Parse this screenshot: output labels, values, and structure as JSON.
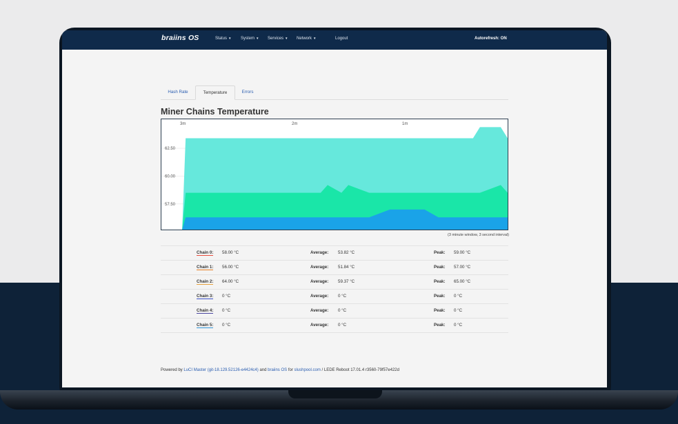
{
  "colors": {
    "navbar": "#0f2a4a",
    "link": "#2a5db0",
    "chain0": "#e74c3c",
    "chain1": "#e67e22",
    "chain2": "#e6a23c",
    "chain3": "#3a4fc6",
    "chain4": "#4a45a0",
    "chain5": "#2f95d8",
    "area_top": "#66e8dc",
    "area_mid": "#1ae6a8",
    "area_bottom": "#1aa3e8"
  },
  "navbar": {
    "brand": "braiins OS",
    "items": [
      {
        "label": "Status",
        "caret": "▼"
      },
      {
        "label": "System",
        "caret": "▼"
      },
      {
        "label": "Services",
        "caret": "▼"
      },
      {
        "label": "Network",
        "caret": "▼"
      },
      {
        "label": "Logout",
        "caret": ""
      }
    ],
    "autorefresh": "Autorefresh: ON"
  },
  "tabs": [
    {
      "label": "Hash Rate",
      "active": false
    },
    {
      "label": "Temperature",
      "active": true
    },
    {
      "label": "Errors",
      "active": false
    }
  ],
  "page_title": "Miner Chains Temperature",
  "chart_data": {
    "type": "area",
    "x_ticks": [
      "3m",
      "2m",
      "1m"
    ],
    "y_ticks": [
      "62.50",
      "60.00",
      "57.50"
    ],
    "ylim": [
      55.2,
      65.1
    ],
    "x": [
      0,
      6,
      7,
      40,
      46,
      48,
      52,
      54,
      60,
      66,
      76,
      80,
      90,
      92,
      98,
      100
    ],
    "series": [
      {
        "color": "#66e8dc",
        "values": [
          55.2,
          55.2,
          63.4,
          63.4,
          63.4,
          63.4,
          63.4,
          63.4,
          63.4,
          63.4,
          63.4,
          63.4,
          63.4,
          64.4,
          64.4,
          63.4
        ]
      },
      {
        "color": "#1ae6a8",
        "values": [
          55.2,
          55.2,
          58.5,
          58.5,
          58.5,
          59.2,
          58.5,
          59.2,
          58.5,
          58.5,
          58.5,
          58.5,
          58.5,
          58.5,
          59.2,
          58.5
        ]
      },
      {
        "color": "#1aa3e8",
        "values": [
          55.2,
          55.2,
          56.3,
          56.3,
          56.3,
          56.3,
          56.3,
          56.3,
          56.3,
          57.0,
          57.0,
          56.3,
          56.3,
          56.3,
          56.3,
          56.3
        ]
      }
    ]
  },
  "chart_note": "(3 minute window, 3 second interval)",
  "chains": [
    {
      "label": "Chain 0:",
      "value": "58.00 °C",
      "avg_label": "Average:",
      "avg": "53.82 °C",
      "peak_label": "Peak:",
      "peak": "59.00 °C",
      "color": "#e74c3c"
    },
    {
      "label": "Chain 1:",
      "value": "56.00 °C",
      "avg_label": "Average:",
      "avg": "51.84 °C",
      "peak_label": "Peak:",
      "peak": "57.00 °C",
      "color": "#e67e22"
    },
    {
      "label": "Chain 2:",
      "value": "64.00 °C",
      "avg_label": "Average:",
      "avg": "59.37 °C",
      "peak_label": "Peak:",
      "peak": "65.00 °C",
      "color": "#e6a23c"
    },
    {
      "label": "Chain 3:",
      "value": "0 °C",
      "avg_label": "Average:",
      "avg": "0 °C",
      "peak_label": "Peak:",
      "peak": "0 °C",
      "color": "#3a4fc6"
    },
    {
      "label": "Chain 4:",
      "value": "0 °C",
      "avg_label": "Average:",
      "avg": "0 °C",
      "peak_label": "Peak:",
      "peak": "0 °C",
      "color": "#4a45a0"
    },
    {
      "label": "Chain 5:",
      "value": "0 °C",
      "avg_label": "Average:",
      "avg": "0 °C",
      "peak_label": "Peak:",
      "peak": "0 °C",
      "color": "#2f95d8"
    }
  ],
  "footer": {
    "powered_by": "Powered by",
    "luci": "LuCI Master (git-18.129.52126-e4424c4)",
    "and": "and",
    "braiins": "braiins OS",
    "for": "for",
    "slushpool": "slushpool.com",
    "lede": "/ LEDE Reboot 17.01.4 r3560-79f57e422d"
  }
}
